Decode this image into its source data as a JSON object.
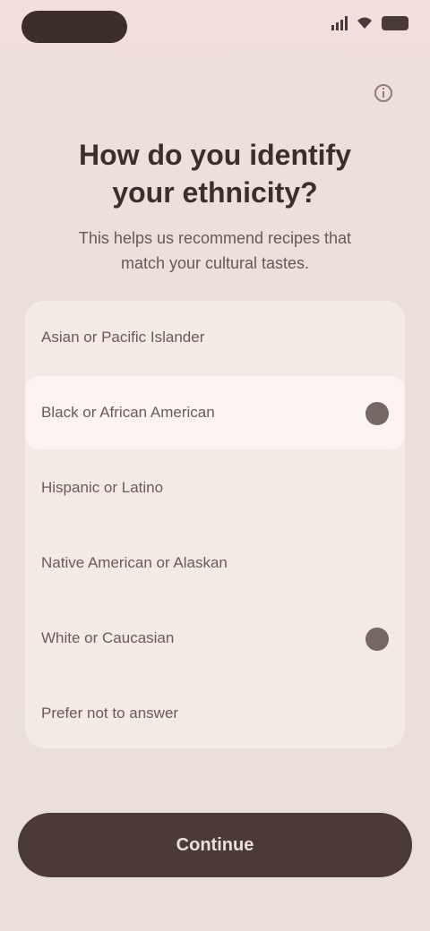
{
  "status_bar": {
    "time": "",
    "signal_icon": "signal-icon",
    "wifi_icon": "wifi-icon",
    "battery_icon": "battery-icon"
  },
  "header": {
    "info_icon": "info-icon",
    "title": "How do you identify your ethnicity?",
    "subtitle": "This helps us recommend recipes that match your cultural tastes."
  },
  "options": [
    {
      "label": "Asian or Pacific Islander"
    },
    {
      "label": "Black or African American"
    },
    {
      "label": "Hispanic or Latino"
    },
    {
      "label": "Native American or Alaskan"
    },
    {
      "label": "White or Caucasian"
    },
    {
      "label": "Prefer not to answer"
    }
  ],
  "primary_button": {
    "label": "Continue"
  },
  "colors": {
    "background": "#ecdfd9",
    "card": "#f3e9e5",
    "selected": "#fbf4f2",
    "accent": "#4b3a36"
  }
}
